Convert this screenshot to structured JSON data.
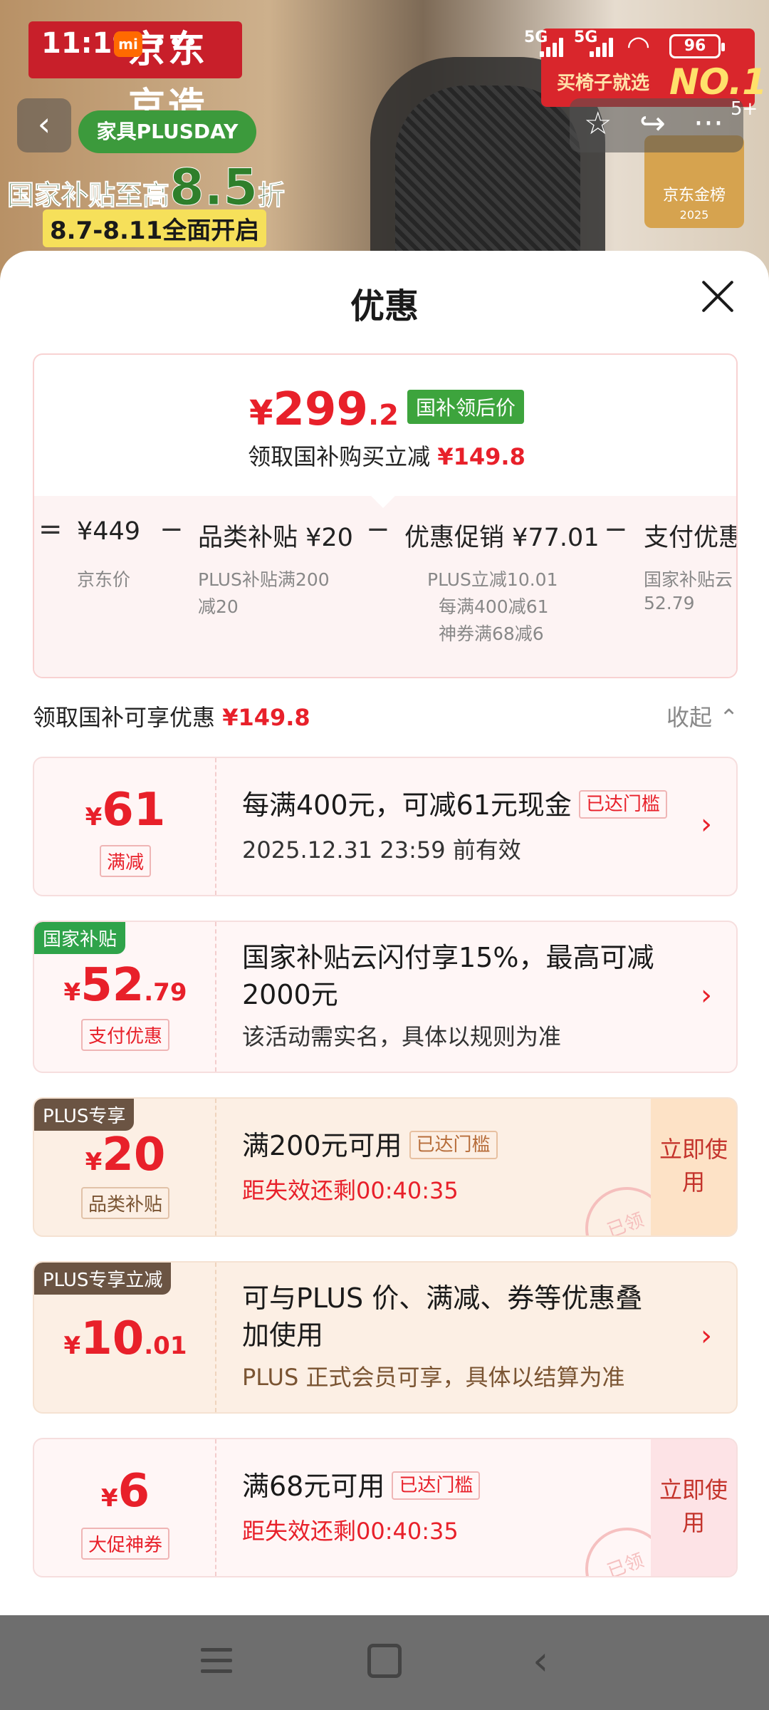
{
  "status_bar": {
    "time": "11:19",
    "mi_badge": "mi",
    "more_dots": "•••",
    "net1": "5G",
    "net2": "5G",
    "battery": "96"
  },
  "background_promo": {
    "store_title": "京东京造",
    "plus_day": "家具PLUSDAY",
    "subsidy_line_prefix": "国家补贴至高",
    "subsidy_line_value": "8.5",
    "subsidy_line_suffix": "折",
    "date_line": "8.7-8.11全面开启",
    "right_line1": "买椅子就选",
    "right_line2": "NO.1",
    "rank_badge": "京东金榜",
    "rank_year": "2025",
    "notif_count": "5+"
  },
  "sheet": {
    "title": "优惠",
    "summary": {
      "currency": "¥",
      "final_price_main": "299",
      "final_price_decimal": ".2",
      "final_tag": "国补领后价",
      "saved_label": "领取国补购买立减",
      "saved_amount": "¥149.8",
      "breakdown": [
        {
          "op": "=",
          "label": "¥449",
          "subs": [
            "京东价"
          ]
        },
        {
          "op": "−",
          "label": "品类补贴 ¥20",
          "subs": [
            "PLUS补贴满200",
            "减20"
          ]
        },
        {
          "op": "−",
          "label": "优惠促销 ¥77.01",
          "subs": [
            "PLUS立减10.01",
            "每满400减61",
            "神券满68减6"
          ]
        },
        {
          "op": "−",
          "label": "支付优惠",
          "subs": [
            "国家补贴云",
            "52.79"
          ]
        }
      ]
    },
    "section_label": "领取国补可享优惠",
    "section_amount": "¥149.8",
    "collapse_label": "收起",
    "coupons": [
      {
        "currency": "¥",
        "value": "61",
        "decimal": "",
        "kind": "满减",
        "corner": "",
        "title": "每满400元，可减61元现金",
        "reached": "已达门槛",
        "subtitle": "2025.12.31 23:59 前有效",
        "action": ""
      },
      {
        "currency": "¥",
        "value": "52",
        "decimal": ".79",
        "kind": "支付优惠",
        "corner": "国家补贴",
        "title": "国家补贴云闪付享15%，最高可减2000元",
        "reached": "",
        "subtitle": "该活动需实名，具体以规则为准",
        "action": ""
      },
      {
        "currency": "¥",
        "value": "20",
        "decimal": "",
        "kind": "品类补贴",
        "corner": "PLUS专享",
        "title": "满200元可用",
        "reached": "已达门槛",
        "subtitle": "距失效还剩00:40:35",
        "action": "立即使用",
        "stamp": "已领"
      },
      {
        "currency": "¥",
        "value": "10",
        "decimal": ".01",
        "kind": "",
        "corner": "PLUS专享立减",
        "title": "可与PLUS 价、满减、券等优惠叠加使用",
        "reached": "",
        "subtitle": "PLUS 正式会员可享，具体以结算为准",
        "action": ""
      },
      {
        "currency": "¥",
        "value": "6",
        "decimal": "",
        "kind": "大促神券",
        "corner": "",
        "title": "满68元可用",
        "reached": "已达门槛",
        "subtitle": "距失效还剩00:40:35",
        "action": "立即使用",
        "stamp": "已领"
      }
    ]
  },
  "colors": {
    "accent_red": "#e8202a",
    "green_tag": "#3da43d",
    "plus_brown": "#6b5443"
  }
}
